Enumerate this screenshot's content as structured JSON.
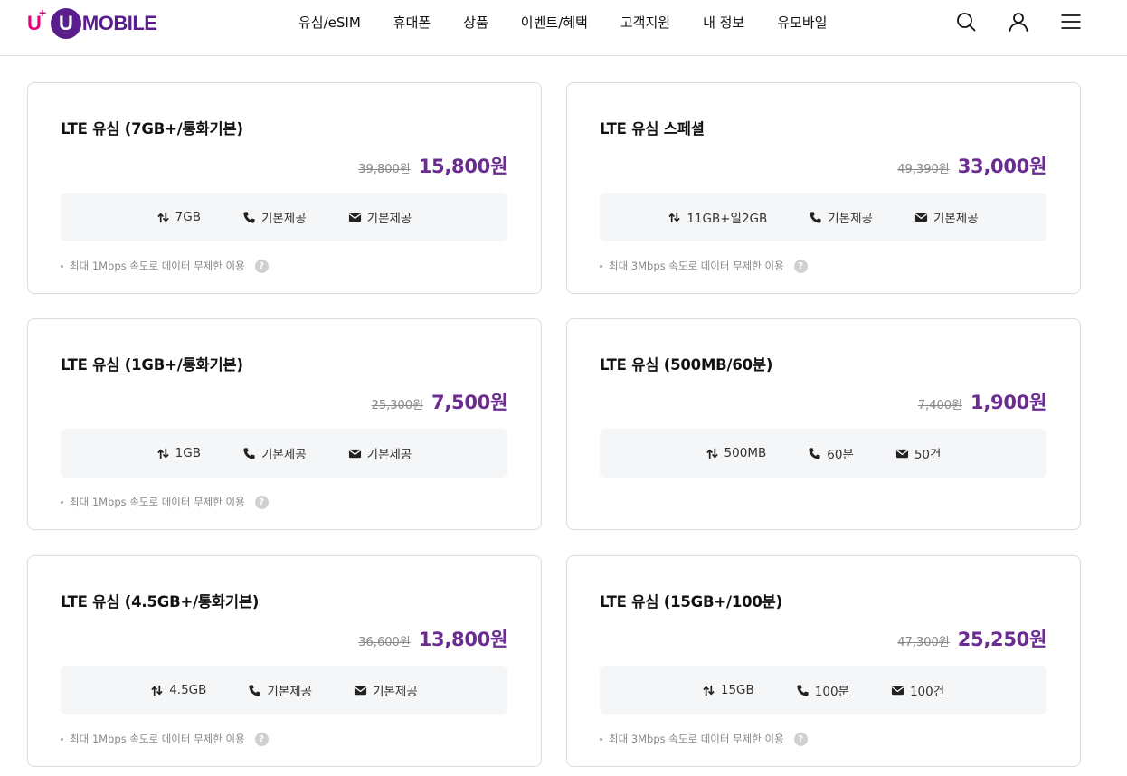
{
  "brand": {
    "prefix": "U",
    "plus": "+",
    "circle": "U",
    "name": "MOBILE"
  },
  "nav": [
    "유심/eSIM",
    "휴대폰",
    "상품",
    "이벤트/혜택",
    "고객지원",
    "내 정보",
    "유모바일"
  ],
  "header_icons": [
    "search-icon",
    "user-icon",
    "menu-icon"
  ],
  "colors": {
    "brand_purple": "#6b2c91",
    "brand_magenta": "#e6007e",
    "spec_bg": "#f5f6f8"
  },
  "plans": [
    {
      "title": "LTE 유심 (7GB+/통화기본)",
      "original_price": "39,800원",
      "sale_price": "15,800원",
      "data": "7GB",
      "voice": "기본제공",
      "sms": "기본제공",
      "note": "최대 1Mbps 속도로 데이터 무제한 이용"
    },
    {
      "title": "LTE 유심 스페셜",
      "original_price": "49,390원",
      "sale_price": "33,000원",
      "data": "11GB+일2GB",
      "voice": "기본제공",
      "sms": "기본제공",
      "note": "최대 3Mbps 속도로 데이터 무제한 이용"
    },
    {
      "title": "LTE 유심 (1GB+/통화기본)",
      "original_price": "25,300원",
      "sale_price": "7,500원",
      "data": "1GB",
      "voice": "기본제공",
      "sms": "기본제공",
      "note": "최대 1Mbps 속도로 데이터 무제한 이용"
    },
    {
      "title": "LTE 유심 (500MB/60분)",
      "original_price": "7,400원",
      "sale_price": "1,900원",
      "data": "500MB",
      "voice": "60분",
      "sms": "50건",
      "note": ""
    },
    {
      "title": "LTE 유심 (4.5GB+/통화기본)",
      "original_price": "36,600원",
      "sale_price": "13,800원",
      "data": "4.5GB",
      "voice": "기본제공",
      "sms": "기본제공",
      "note": "최대 1Mbps 속도로 데이터 무제한 이용"
    },
    {
      "title": "LTE 유심 (15GB+/100분)",
      "original_price": "47,300원",
      "sale_price": "25,250원",
      "data": "15GB",
      "voice": "100분",
      "sms": "100건",
      "note": "최대 3Mbps 속도로 데이터 무제한 이용"
    }
  ]
}
